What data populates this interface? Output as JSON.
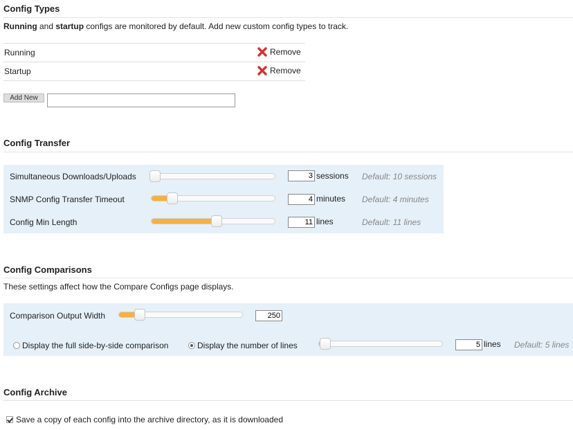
{
  "config_types": {
    "title": "Config Types",
    "desc_bold1": "Running",
    "desc_and": " and ",
    "desc_bold2": "startup",
    "desc_rest": " configs are monitored by default. Add new custom config types to track.",
    "rows": [
      {
        "name": "Running",
        "remove_label": "Remove"
      },
      {
        "name": "Startup",
        "remove_label": "Remove"
      }
    ],
    "add_new_label": "Add New",
    "add_new_value": ""
  },
  "config_transfer": {
    "title": "Config Transfer",
    "settings": [
      {
        "label": "Simultaneous Downloads/Uploads",
        "value": "3",
        "unit": "sessions",
        "default": "Default: 10 sessions",
        "level": 0.0
      },
      {
        "label": "SNMP Config Transfer Timeout",
        "value": "4",
        "unit": "minutes",
        "default": "Default: 4 minutes",
        "level": 0.14
      },
      {
        "label": "Config Min Length",
        "value": "11",
        "unit": "lines",
        "default": "Default: 11 lines",
        "level": 0.53
      }
    ]
  },
  "config_comparisons": {
    "title": "Config Comparisons",
    "desc": "These settings affect how the Compare Configs page displays.",
    "output_width": {
      "label": "Comparison Output Width",
      "value": "250",
      "level": 0.13
    },
    "radio_full": {
      "label": "Display the full side-by-side comparison",
      "checked": false
    },
    "radio_lines": {
      "label": "Display the number of lines",
      "checked": true
    },
    "lines": {
      "value": "5",
      "unit": "lines",
      "default": "Default: 5 lines",
      "level": 0.0
    }
  },
  "config_archive": {
    "title": "Config Archive",
    "checkbox_label": "Save a copy of each config into the archive directory, as it is downloaded",
    "checked": true
  },
  "colors": {
    "accent": "#f5b042",
    "panel": "#e5f0f8",
    "remove_icon": "#d9302c"
  }
}
